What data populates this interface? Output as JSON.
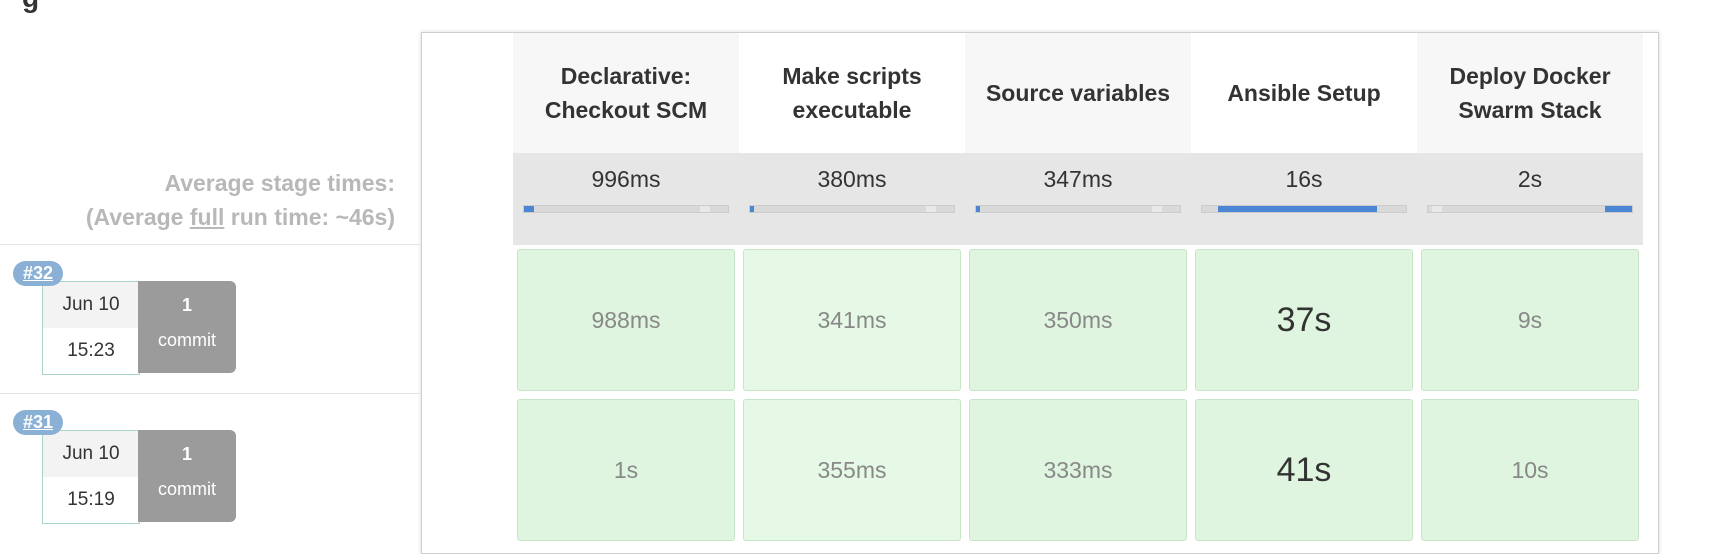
{
  "summary": {
    "avg_line1": "Average stage times:",
    "avg_prefix": "(Average ",
    "avg_full": "full",
    "avg_suffix": " run time: ~46s)"
  },
  "stages": [
    {
      "name": "Declarative: Checkout SCM",
      "avg": "996ms",
      "avg_fraction": 0.05
    },
    {
      "name": "Make scripts executable",
      "avg": "380ms",
      "avg_fraction": 0.02
    },
    {
      "name": "Source variables",
      "avg": "347ms",
      "avg_fraction": 0.02
    },
    {
      "name": "Ansible Setup",
      "avg": "16s",
      "avg_fraction": 0.78
    },
    {
      "name": "Deploy Docker Swarm Stack",
      "avg": "2s",
      "avg_fraction": 0.13
    }
  ],
  "builds": [
    {
      "number": "#32",
      "date": "Jun 10",
      "time": "15:23",
      "commits_count": "1",
      "commits_label": "commit",
      "durations": [
        "988ms",
        "341ms",
        "350ms",
        "37s",
        "9s"
      ]
    },
    {
      "number": "#31",
      "date": "Jun 10",
      "time": "15:19",
      "commits_count": "1",
      "commits_label": "commit",
      "durations": [
        "1s",
        "355ms",
        "333ms",
        "41s",
        "10s"
      ]
    }
  ],
  "colors": {
    "success_cell": "#dff5df",
    "progress_fill": "#4a86d4",
    "badge": "#8bb0d6"
  }
}
